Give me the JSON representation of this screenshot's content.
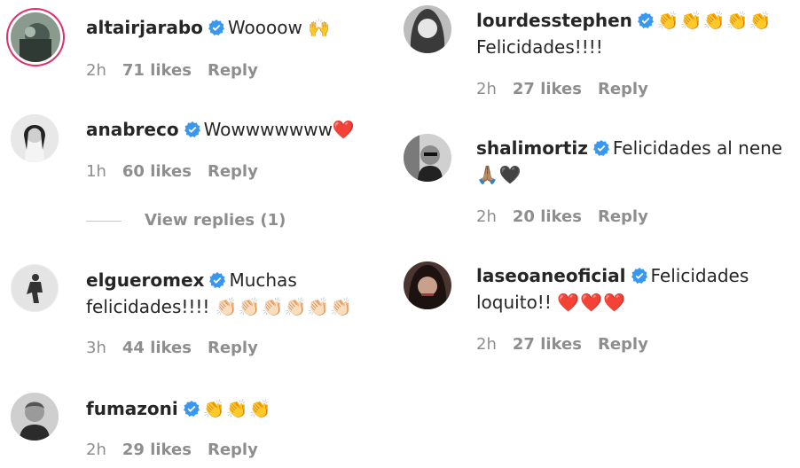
{
  "comments": [
    {
      "username": "altairjarabo",
      "text": "Woooow",
      "emoji": "🙌",
      "time": "2h",
      "likes": "71 likes",
      "reply": "Reply"
    },
    {
      "username": "anabreco",
      "text": "Wowwwwwww",
      "emoji": "❤️",
      "time": "1h",
      "likes": "60 likes",
      "reply": "Reply",
      "view_replies": "View replies (1)"
    },
    {
      "username": "elgueromex",
      "text": "Muchas",
      "text2": "felicidades!!!!",
      "emoji": "👏🏻👏🏻👏🏻👏🏻👏🏻👏🏻",
      "time": "3h",
      "likes": "44 likes",
      "reply": "Reply"
    },
    {
      "username": "fumazoni",
      "text": "",
      "emoji": "👏👏👏",
      "time": "2h",
      "likes": "29 likes",
      "reply": "Reply"
    },
    {
      "username": "lourdesstephen",
      "text": "Felicidades!!!!",
      "emoji": "👏👏👏👏👏",
      "time": "2h",
      "likes": "27 likes",
      "reply": "Reply"
    },
    {
      "username": "shalimortiz",
      "text": "Felicidades al nene",
      "emoji": "🙏🏽🖤",
      "time": "2h",
      "likes": "20 likes",
      "reply": "Reply"
    },
    {
      "username": "laseoaneoficial",
      "text": "Felicidades",
      "text2": "loquito!!",
      "emoji": "❤️❤️❤️",
      "time": "2h",
      "likes": "27 likes",
      "reply": "Reply"
    }
  ],
  "colors": {
    "verified": "#3897f0",
    "muted": "#8e8e8e",
    "text": "#262626",
    "heart": "#e0245e",
    "ring": "#e1306c"
  },
  "icons": {
    "verified": "verified-badge-icon"
  }
}
